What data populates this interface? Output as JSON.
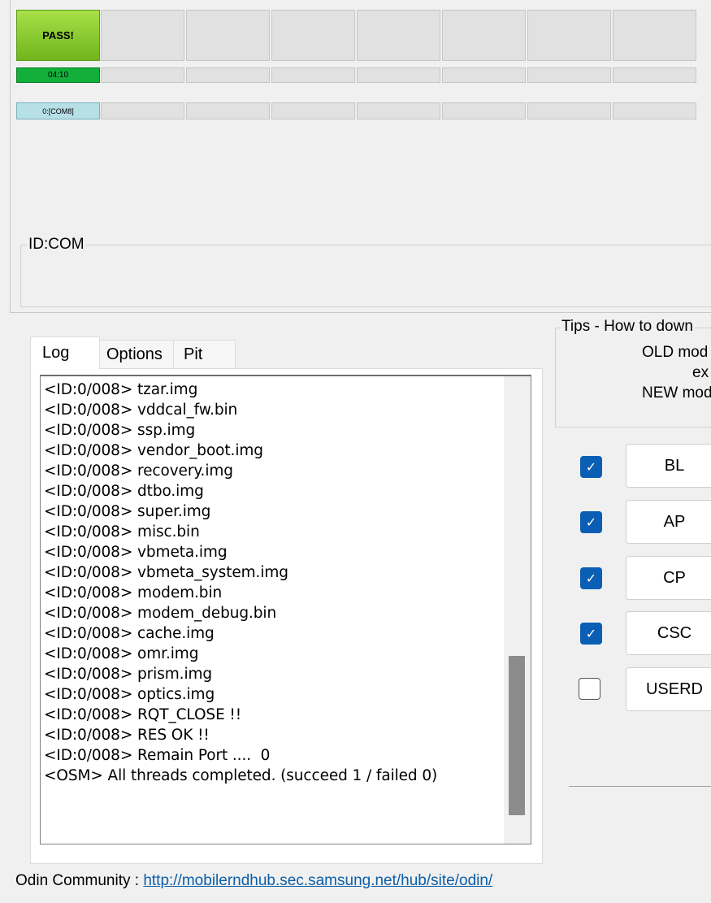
{
  "slots": [
    {
      "status": "PASS!",
      "time": "04:10",
      "port": "0:[COM8]",
      "active": true
    },
    {
      "status": "",
      "time": "",
      "port": "",
      "active": false
    },
    {
      "status": "",
      "time": "",
      "port": "",
      "active": false
    },
    {
      "status": "",
      "time": "",
      "port": "",
      "active": false
    },
    {
      "status": "",
      "time": "",
      "port": "",
      "active": false
    },
    {
      "status": "",
      "time": "",
      "port": "",
      "active": false
    },
    {
      "status": "",
      "time": "",
      "port": "",
      "active": false
    },
    {
      "status": "",
      "time": "",
      "port": "",
      "active": false
    }
  ],
  "idcom": {
    "label": "ID:COM"
  },
  "tabs": [
    {
      "label": "Log",
      "selected": true
    },
    {
      "label": "Options",
      "selected": false
    },
    {
      "label": "Pit",
      "selected": false
    }
  ],
  "log": {
    "lines": [
      "<ID:0/008> tzar.img",
      "<ID:0/008> vddcal_fw.bin",
      "<ID:0/008> ssp.img",
      "<ID:0/008> vendor_boot.img",
      "<ID:0/008> recovery.img",
      "<ID:0/008> dtbo.img",
      "<ID:0/008> super.img",
      "<ID:0/008> misc.bin",
      "<ID:0/008> vbmeta.img",
      "<ID:0/008> vbmeta_system.img",
      "<ID:0/008> modem.bin",
      "<ID:0/008> modem_debug.bin",
      "<ID:0/008> cache.img",
      "<ID:0/008> omr.img",
      "<ID:0/008> prism.img",
      "<ID:0/008> optics.img",
      "<ID:0/008> RQT_CLOSE !!",
      "<ID:0/008> RES OK !!",
      "<ID:0/008> Remain Port ....  0",
      "<OSM> All threads completed. (succeed 1 / failed 0)"
    ]
  },
  "tips": {
    "title": "Tips - How to down",
    "line1": "OLD mod",
    "line2": "ex",
    "line3": "NEW mod"
  },
  "files": [
    {
      "label": "BL",
      "checked": true
    },
    {
      "label": "AP",
      "checked": true
    },
    {
      "label": "CP",
      "checked": true
    },
    {
      "label": "CSC",
      "checked": true
    },
    {
      "label": "USERD",
      "checked": false
    }
  ],
  "footer": {
    "label": "Odin Community : ",
    "link": "http://mobilerndhub.sec.samsung.net/hub/site/odin/"
  },
  "colors": {
    "pass": "#7cc226",
    "timer": "#12b03a",
    "port": "#b7dfe6",
    "checkbox": "#0a5fb4",
    "link": "#0c5fa8"
  }
}
